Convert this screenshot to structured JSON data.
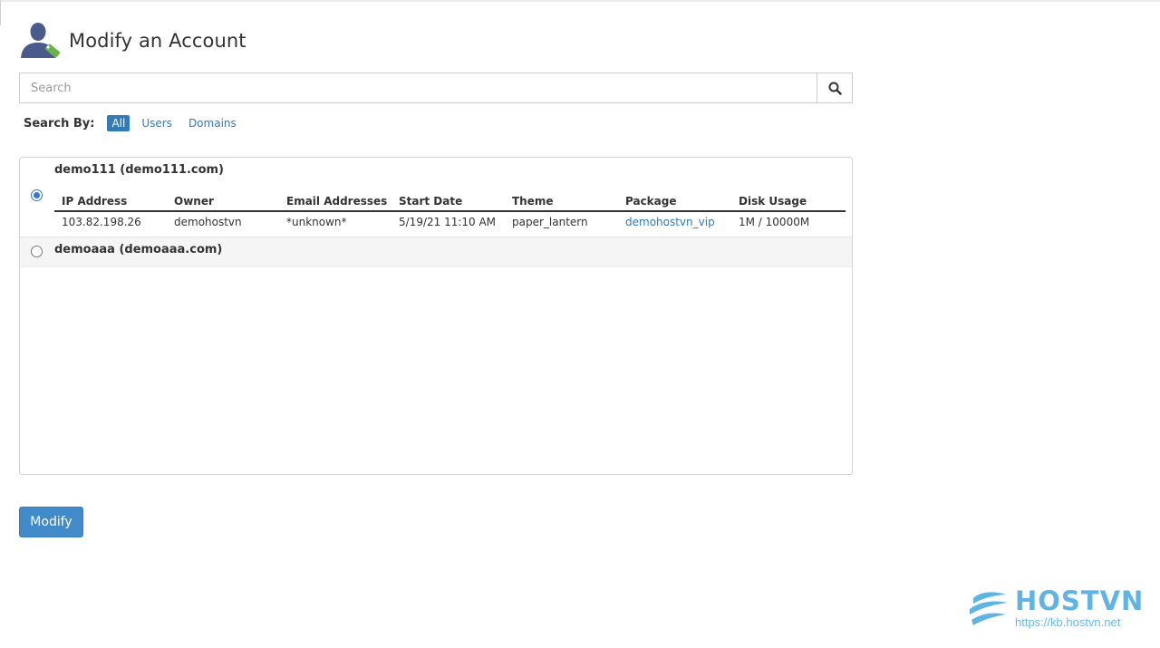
{
  "page": {
    "title": "Modify an Account"
  },
  "search": {
    "placeholder": "Search",
    "value": "",
    "button_icon": "search-icon"
  },
  "search_by": {
    "label": "Search By:",
    "options": [
      "All",
      "Users",
      "Domains"
    ],
    "selected": "All"
  },
  "accounts": [
    {
      "name": "demo111 (demo111.com)",
      "selected": true,
      "columns": [
        "IP Address",
        "Owner",
        "Email Addresses",
        "Start Date",
        "Theme",
        "Package",
        "Disk Usage"
      ],
      "row": [
        "103.82.198.26",
        "demohostvn",
        "*unknown*",
        "5/19/21 11:10 AM",
        "paper_lantern",
        "demohostvn_vip",
        "1M / 10000M"
      ]
    },
    {
      "name": "demoaaa (demoaaa.com)",
      "selected": false
    }
  ],
  "actions": {
    "modify_label": "Modify"
  },
  "watermark": {
    "brand": "HOSTVN",
    "url": "https://kb.hostvn.net"
  },
  "colors": {
    "accent": "#337ab7",
    "button": "#428bca",
    "radio": "#2f7ad6",
    "brand": "#5fb4e4"
  }
}
